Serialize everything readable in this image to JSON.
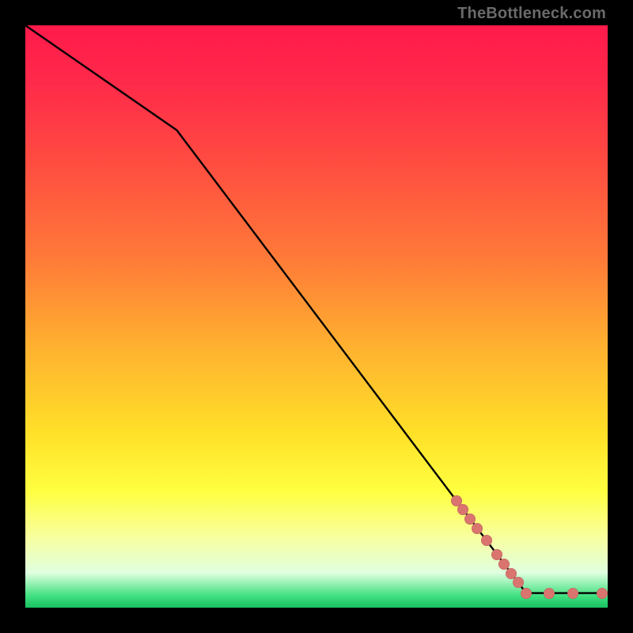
{
  "watermark": "TheBottleneck.com",
  "colors": {
    "dot": "#d9746e",
    "line": "#000000",
    "frame": "#000000"
  },
  "chart_data": {
    "type": "line",
    "title": "",
    "xlabel": "",
    "ylabel": "",
    "xlim": [
      0,
      100
    ],
    "ylim": [
      0,
      100
    ],
    "grid": false,
    "legend": false,
    "line_points": [
      {
        "x": 0,
        "y": 100
      },
      {
        "x": 26,
        "y": 82
      },
      {
        "x": 86,
        "y": 2.5
      },
      {
        "x": 100,
        "y": 2.5
      }
    ],
    "scatter_points": [
      {
        "x": 74,
        "y": 18.4
      },
      {
        "x": 75.2,
        "y": 16.8
      },
      {
        "x": 76.4,
        "y": 15.2
      },
      {
        "x": 77.6,
        "y": 13.6
      },
      {
        "x": 79.2,
        "y": 11.5
      },
      {
        "x": 81.0,
        "y": 9.1
      },
      {
        "x": 82.2,
        "y": 7.5
      },
      {
        "x": 83.4,
        "y": 5.9
      },
      {
        "x": 84.6,
        "y": 4.3
      },
      {
        "x": 86.0,
        "y": 2.5
      },
      {
        "x": 90.0,
        "y": 2.5
      },
      {
        "x": 94.0,
        "y": 2.5
      },
      {
        "x": 99.0,
        "y": 2.5
      }
    ]
  }
}
